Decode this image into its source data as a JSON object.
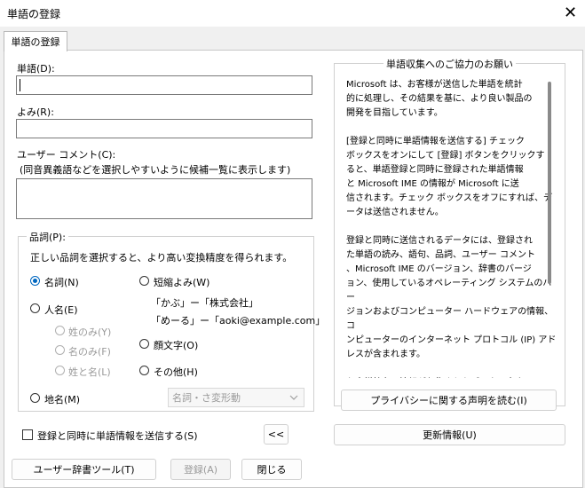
{
  "window": {
    "title": "単語の登録",
    "close_glyph": "✕"
  },
  "tab": {
    "label": "単語の登録"
  },
  "word": {
    "label": "単語(D):",
    "value": ""
  },
  "reading": {
    "label": "よみ(R):",
    "value": ""
  },
  "comment": {
    "label": "ユーザー コメント(C):",
    "hint": "(同音異義語などを選択しやすいように候補一覧に表示します)",
    "value": ""
  },
  "pos": {
    "label": "品詞(P):",
    "description": "正しい品詞を選択すると、より高い変換精度を得られます。",
    "noun": "名詞(N)",
    "person": "人名(E)",
    "surname": "姓のみ(Y)",
    "given": "名のみ(F)",
    "fullname": "姓と名(L)",
    "place": "地名(M)",
    "short": "短縮よみ(W)",
    "short_ex1": "「かぶ」ー「株式会社」",
    "short_ex2": "「めーる」ー「aoki@example.com」",
    "emoticon": "顔文字(O)",
    "other": "その他(H)",
    "select_value": "名詞・さ変形動"
  },
  "info": {
    "title": "単語収集へのご協力のお願い",
    "text": "Microsoft は、お客様が送信した単語を統計\n的に処理し、その結果を基に、より良い製品の\n開発を目指しています。\n\n[登録と同時に単語情報を送信する] チェック\nボックスをオンにして [登録] ボタンをクリックす\nると、単語登録と同時に登録された単語情報\nと Microsoft IME の情報が Microsoft に送\n信されます。チェック ボックスをオフにすれば、デ\nータは送信されません。\n\n登録と同時に送信されるデータには、登録され\nた単語の読み、語句、品詞、ユーザー コメント\n、Microsoft IME のバージョン、辞書のバージ\nョン、使用しているオペレーティング システムのバー\nジョンおよびコンピューター ハードウェアの情報、コ\nンピューターのインターネット プロトコル (IP) アド\nレスが含まれます。\n\nお客様特有の情報が収集されたデータに含ま\nれることがあります。このような情報が存在する\n場合でも、Microsoft では、お客様を特定す\nるために使用することはありません。",
    "privacy_button": "プライバシーに関する声明を読む(I)"
  },
  "send_checkbox": {
    "label": "登録と同時に単語情報を送信する(S)",
    "checked": false
  },
  "collapse_button": "<<",
  "update_button": "更新情報(U)",
  "footer": {
    "dict_tool": "ユーザー辞書ツール(T)",
    "register": "登録(A)",
    "close": "閉じる"
  }
}
